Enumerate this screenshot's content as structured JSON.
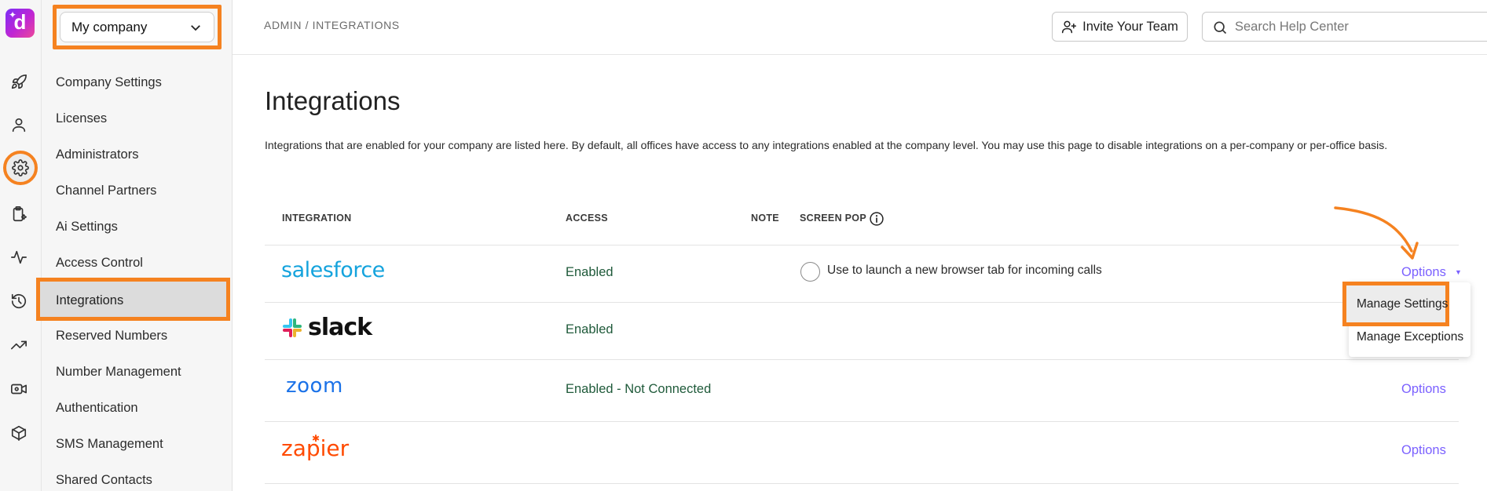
{
  "app": {
    "logo_letter": "d",
    "brand_color": "#7b2ff7",
    "accent_orange": "#f58220"
  },
  "rail": {
    "icons": [
      "rocket-icon",
      "person-icon",
      "gear-icon",
      "clipboard-sparkle-icon",
      "activity-icon",
      "history-icon",
      "trending-icon",
      "video-settings-icon",
      "cube-icon"
    ],
    "active": "gear-icon"
  },
  "sidebar": {
    "company_select": "My company",
    "items": [
      {
        "label": "Company Settings"
      },
      {
        "label": "Licenses"
      },
      {
        "label": "Administrators"
      },
      {
        "label": "Channel Partners"
      },
      {
        "label": "Ai Settings"
      },
      {
        "label": "Access Control"
      },
      {
        "label": "Integrations"
      },
      {
        "label": "Reserved Numbers"
      },
      {
        "label": "Number Management"
      },
      {
        "label": "Authentication"
      },
      {
        "label": "SMS Management"
      },
      {
        "label": "Shared Contacts"
      }
    ],
    "active_index": 6
  },
  "header": {
    "breadcrumb": "ADMIN / INTEGRATIONS",
    "invite_label": "Invite Your Team",
    "search_placeholder": "Search Help Center"
  },
  "main": {
    "title": "Integrations",
    "description": "Integrations that are enabled for your company are listed here. By default, all offices have access to any integrations enabled at the company level. You may use this page to disable integrations on a per-company or per-office basis.",
    "columns": {
      "integration": "INTEGRATION",
      "access": "ACCESS",
      "note": "NOTE",
      "screen_pop": "SCREEN POP"
    },
    "rows": [
      {
        "name": "salesforce",
        "access": "Enabled",
        "screen_pop": "Use to launch a new browser tab for incoming calls",
        "options": "Options",
        "options_color": "#7b61ff"
      },
      {
        "name": "slack",
        "access": "Enabled"
      },
      {
        "name": "zoom",
        "access": "Enabled - Not Connected",
        "options": "Options"
      },
      {
        "name": "zapier",
        "access": "",
        "options": "Options"
      }
    ],
    "menu": [
      "Manage Settings",
      "Manage Exceptions"
    ]
  }
}
